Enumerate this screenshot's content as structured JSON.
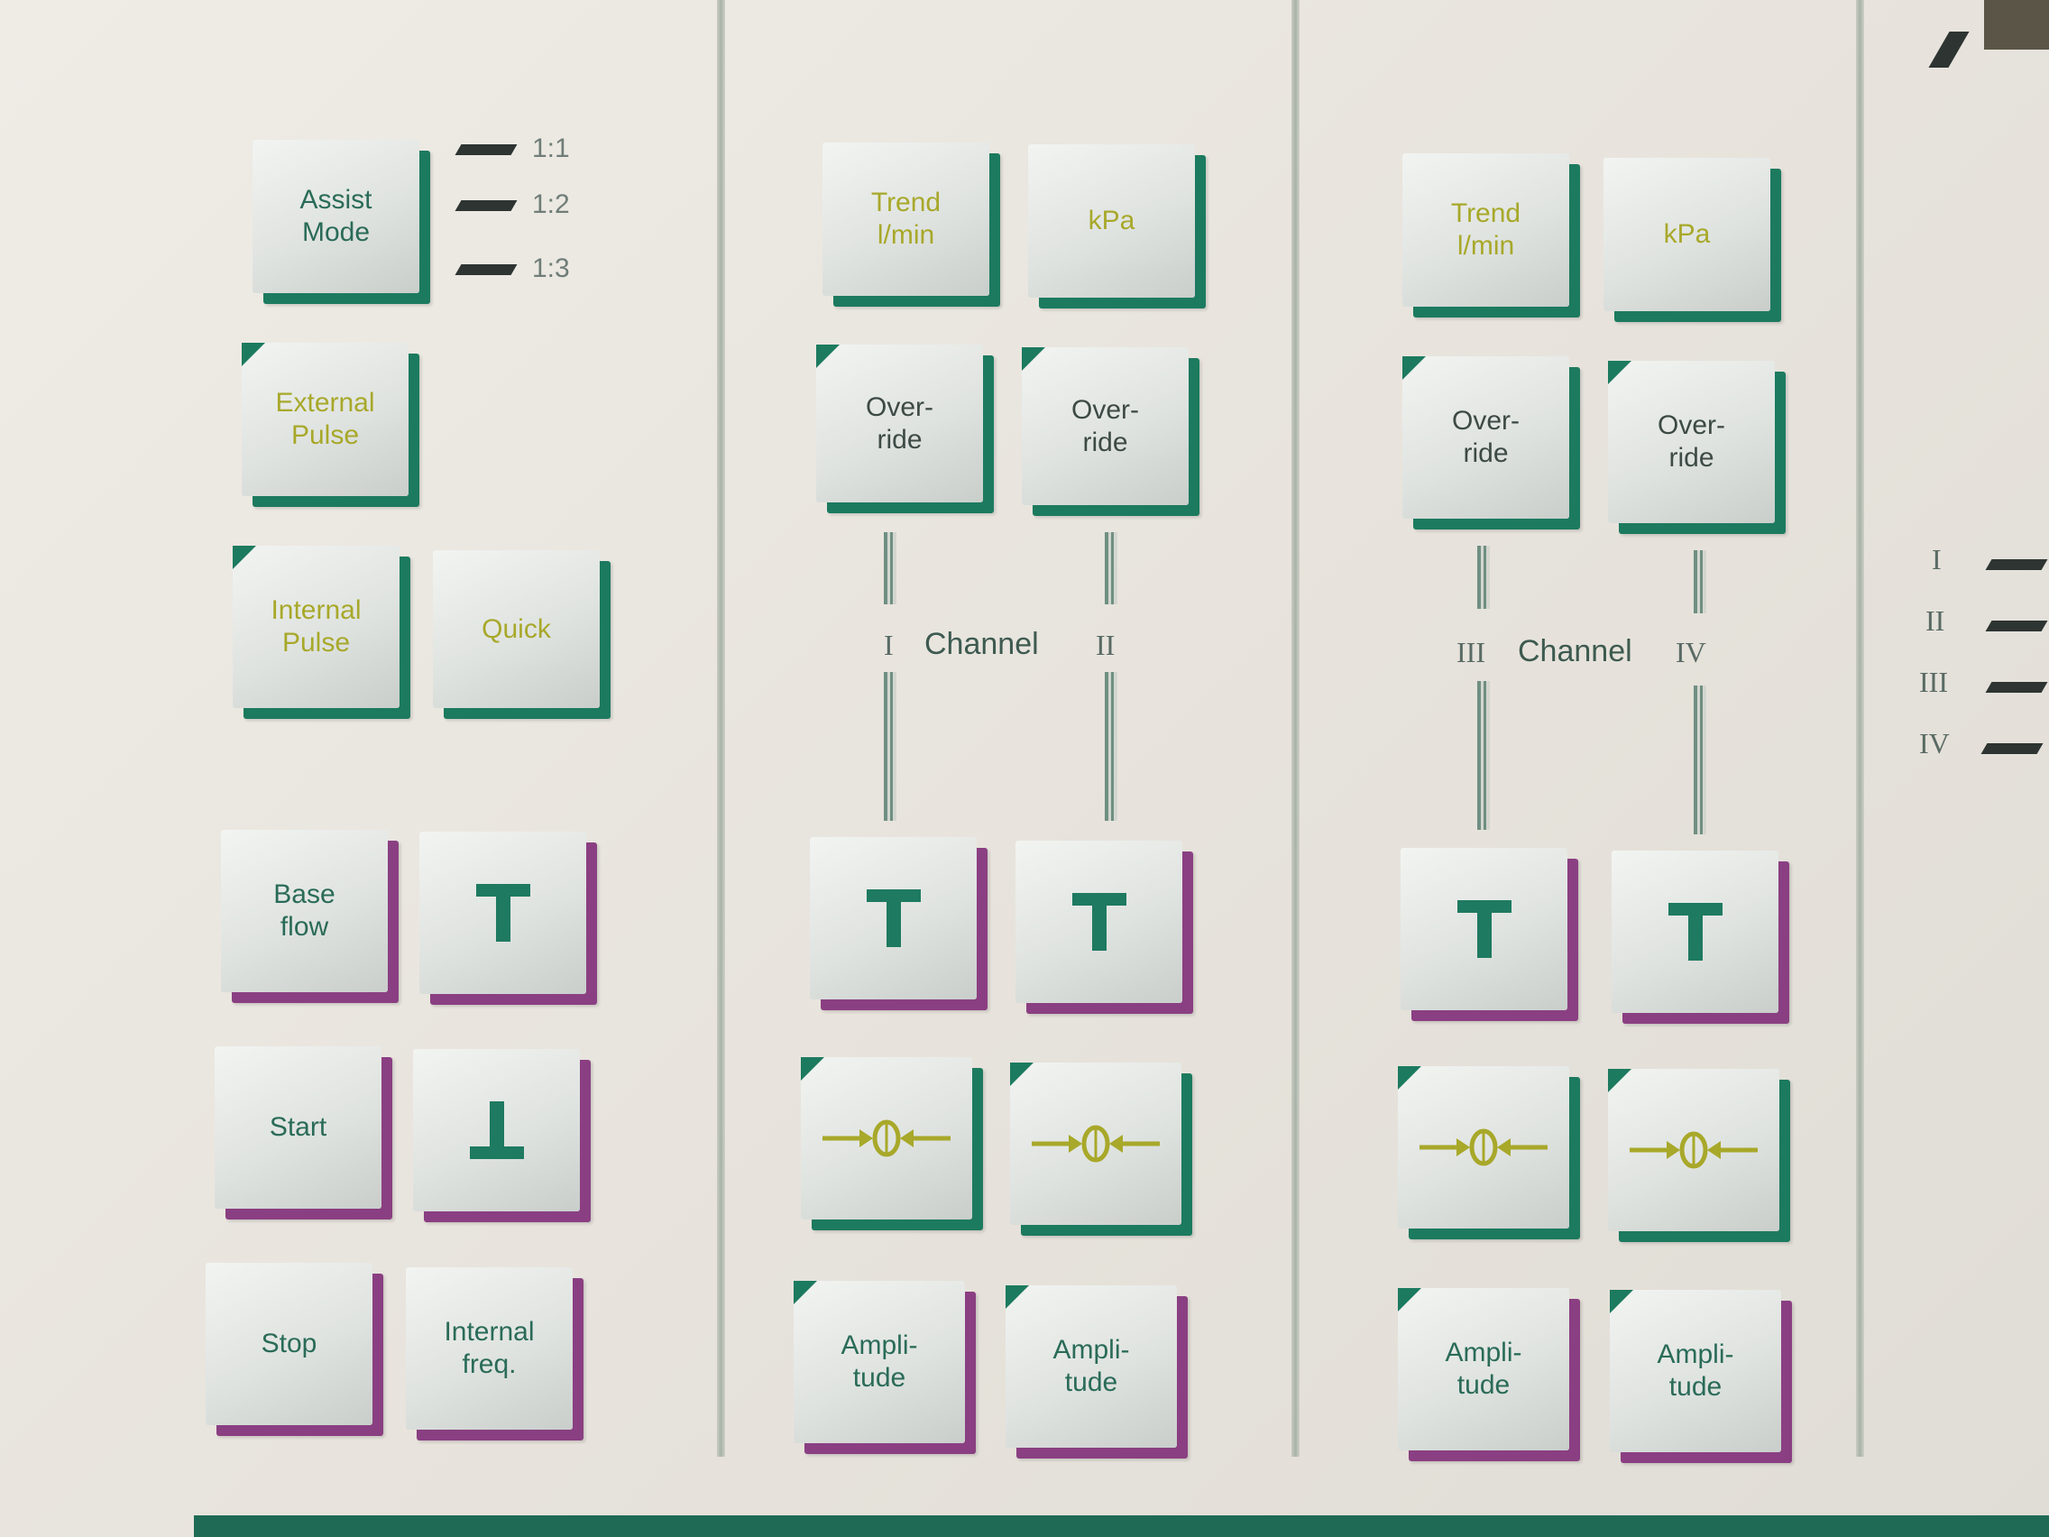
{
  "left_column": {
    "assist_mode": [
      "Assist",
      "Mode"
    ],
    "indicators": [
      "1:1",
      "1:2",
      "1:3"
    ],
    "external_pulse": [
      "External",
      "Pulse"
    ],
    "internal_pulse": [
      "Internal",
      "Pulse"
    ],
    "quick": "Quick",
    "base_flow": [
      "Base",
      "flow"
    ],
    "start": "Start",
    "stop": "Stop",
    "internal_freq": [
      "Internal",
      "freq."
    ]
  },
  "channel_group_1": {
    "trend_1": [
      "Trend",
      "l/min"
    ],
    "kpa_1": "kPa",
    "override": [
      "Over-",
      "ride"
    ],
    "label": "Channel",
    "label_left": "I",
    "label_right": "II",
    "amplitude": [
      "Ampli-",
      "tude"
    ]
  },
  "channel_group_2": {
    "trend_2": [
      "Trend",
      "l/min"
    ],
    "kpa_2": "kPa",
    "override": [
      "Over-",
      "ride"
    ],
    "label": "Channel",
    "label_left": "III",
    "label_right": "IV",
    "amplitude": [
      "Ampli-",
      "tude"
    ]
  },
  "right_indicators": [
    "I",
    "II",
    "III",
    "IV"
  ],
  "colors": {
    "green_edge": "#1c7a5f",
    "purple_edge": "#8a3f82",
    "text_green": "#2a6b58",
    "text_yellow": "#a8a82a"
  }
}
